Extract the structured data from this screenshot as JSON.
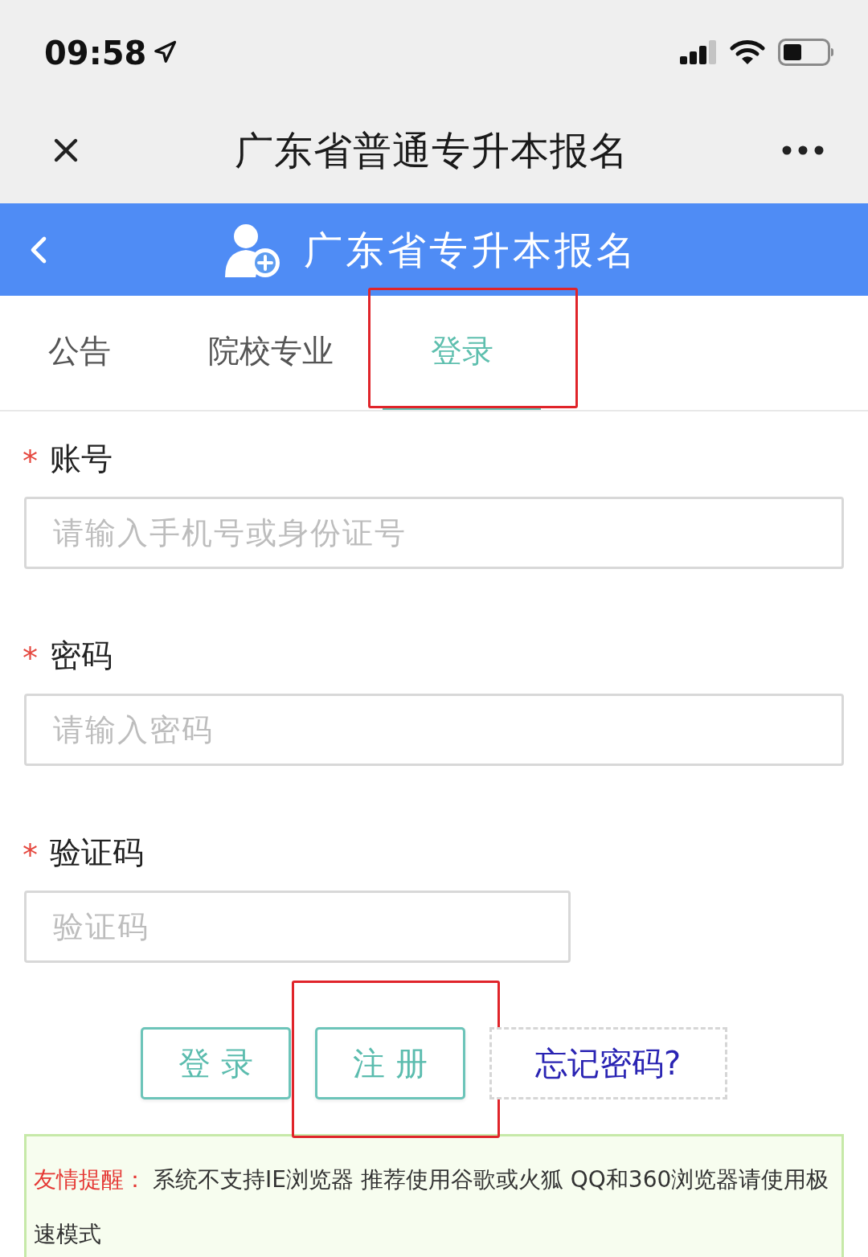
{
  "status_bar": {
    "time": "09:58"
  },
  "nav_bar": {
    "title": "广东省普通专升本报名"
  },
  "header": {
    "title": "广东省专升本报名"
  },
  "tabs": [
    {
      "label": "公告",
      "selected": false,
      "highlighted": false
    },
    {
      "label": "院校专业",
      "selected": false,
      "highlighted": false
    },
    {
      "label": "登录",
      "selected": true,
      "highlighted": true
    }
  ],
  "form": {
    "fields": [
      {
        "mark": "*",
        "label": "账号",
        "placeholder": "请输入手机号或身份证号",
        "kind": "wide"
      },
      {
        "mark": "*",
        "label": "密码",
        "placeholder": "请输入密码",
        "kind": "wide"
      },
      {
        "mark": "*",
        "label": "验证码",
        "placeholder": "验证码",
        "kind": "short"
      }
    ]
  },
  "buttons": [
    {
      "label": "登 录",
      "kind": "outline",
      "highlighted": false
    },
    {
      "label": "注 册",
      "kind": "outline",
      "highlighted": true
    },
    {
      "label": "忘记密码?",
      "kind": "dashed",
      "highlighted": false
    }
  ],
  "notice": {
    "label": "友情提醒：",
    "text": "系统不支持IE浏览器 推荐使用谷歌或火狐 QQ和360浏览器请使用极速模式"
  }
}
